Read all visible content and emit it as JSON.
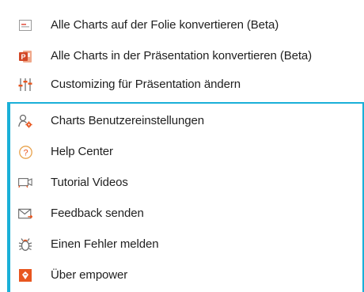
{
  "menu": {
    "items": [
      {
        "label": "Alle Charts auf der Folie konvertieren (Beta)",
        "icon": "chart-slide-icon"
      },
      {
        "label": "Alle Charts in der Präsentation konvertieren (Beta)",
        "icon": "powerpoint-icon"
      },
      {
        "label": "Customizing für Präsentation ändern",
        "icon": "sliders-icon"
      },
      {
        "label": "Charts Benutzereinstellungen",
        "icon": "user-settings-icon"
      },
      {
        "label": "Help Center",
        "icon": "help-icon"
      },
      {
        "label": "Tutorial Videos",
        "icon": "video-icon"
      },
      {
        "label": "Feedback senden",
        "icon": "mail-icon"
      },
      {
        "label": "Einen Fehler melden",
        "icon": "bug-icon"
      },
      {
        "label": "Über empower",
        "icon": "empower-logo-icon"
      }
    ]
  },
  "colors": {
    "accent": "#1ab0d8",
    "orange": "#e8561f",
    "gray_icon": "#7a7a7a"
  }
}
